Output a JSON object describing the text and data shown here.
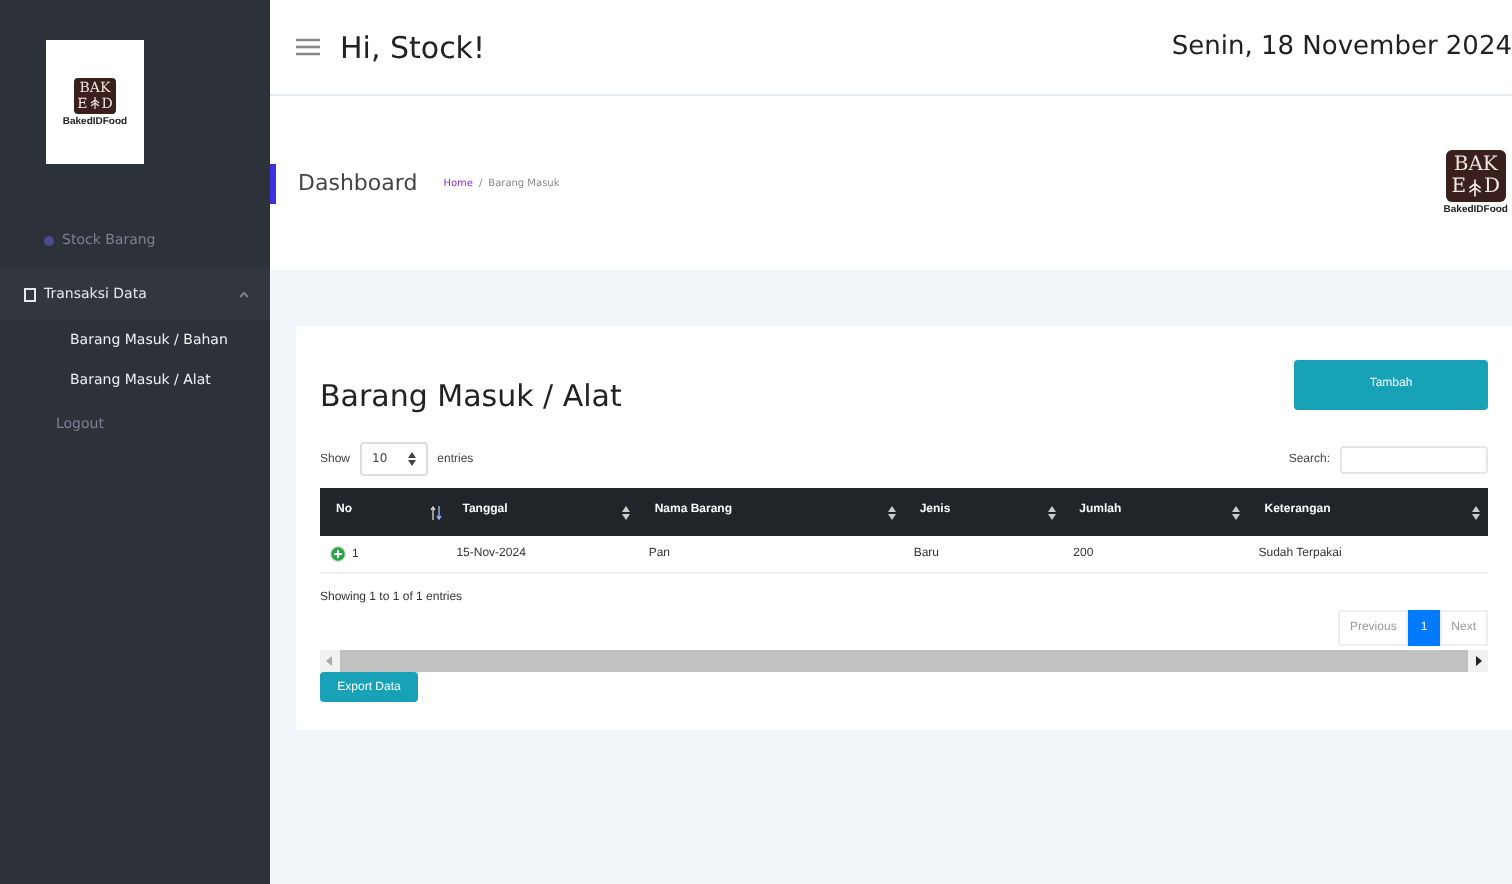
{
  "sidebar": {
    "logo": {
      "top": "BAK",
      "left": "E",
      "right": "D",
      "caption": "BakedIDFood"
    },
    "items": [
      {
        "kind": "link",
        "label": "Stock Barang"
      },
      {
        "kind": "group",
        "label": "Transaksi Data",
        "expanded": true,
        "children": [
          {
            "label": "Barang Masuk / Bahan"
          },
          {
            "label": "Barang Masuk / Alat"
          }
        ]
      },
      {
        "kind": "link",
        "label": "Logout"
      }
    ]
  },
  "header": {
    "greeting": "Hi, Stock!",
    "date": "Senin, 18 November 2024"
  },
  "page_bar": {
    "title": "Dashboard",
    "breadcrumb": [
      {
        "label": "Home",
        "link": true
      },
      {
        "label": "/",
        "link": false
      },
      {
        "label": "Barang Masuk",
        "link": false
      }
    ],
    "logo": {
      "top": "BAK",
      "left": "E",
      "right": "D",
      "caption": "BakedIDFood"
    }
  },
  "card": {
    "title": "Barang Masuk / Alat",
    "add_button": "Tambah",
    "length": {
      "before": "Show",
      "value": "10",
      "after": "entries"
    },
    "search_label": "Search:",
    "table": {
      "columns": [
        {
          "label": "No",
          "sorted": true
        },
        {
          "label": "Tanggal",
          "sorted": false
        },
        {
          "label": "Nama Barang",
          "sorted": false
        },
        {
          "label": "Jenis",
          "sorted": false
        },
        {
          "label": "Jumlah",
          "sorted": false
        },
        {
          "label": "Keterangan",
          "sorted": false
        }
      ],
      "rows": [
        [
          "1",
          "15-Nov-2024",
          "Pan",
          "Baru",
          "200",
          "Sudah Terpakai"
        ]
      ]
    },
    "info": "Showing 1 to 1 of 1 entries",
    "pagination": [
      {
        "label": "Previous",
        "selected": false
      },
      {
        "label": "1",
        "selected": true
      },
      {
        "label": "Next",
        "selected": false
      }
    ],
    "export_button": "Export Data"
  }
}
